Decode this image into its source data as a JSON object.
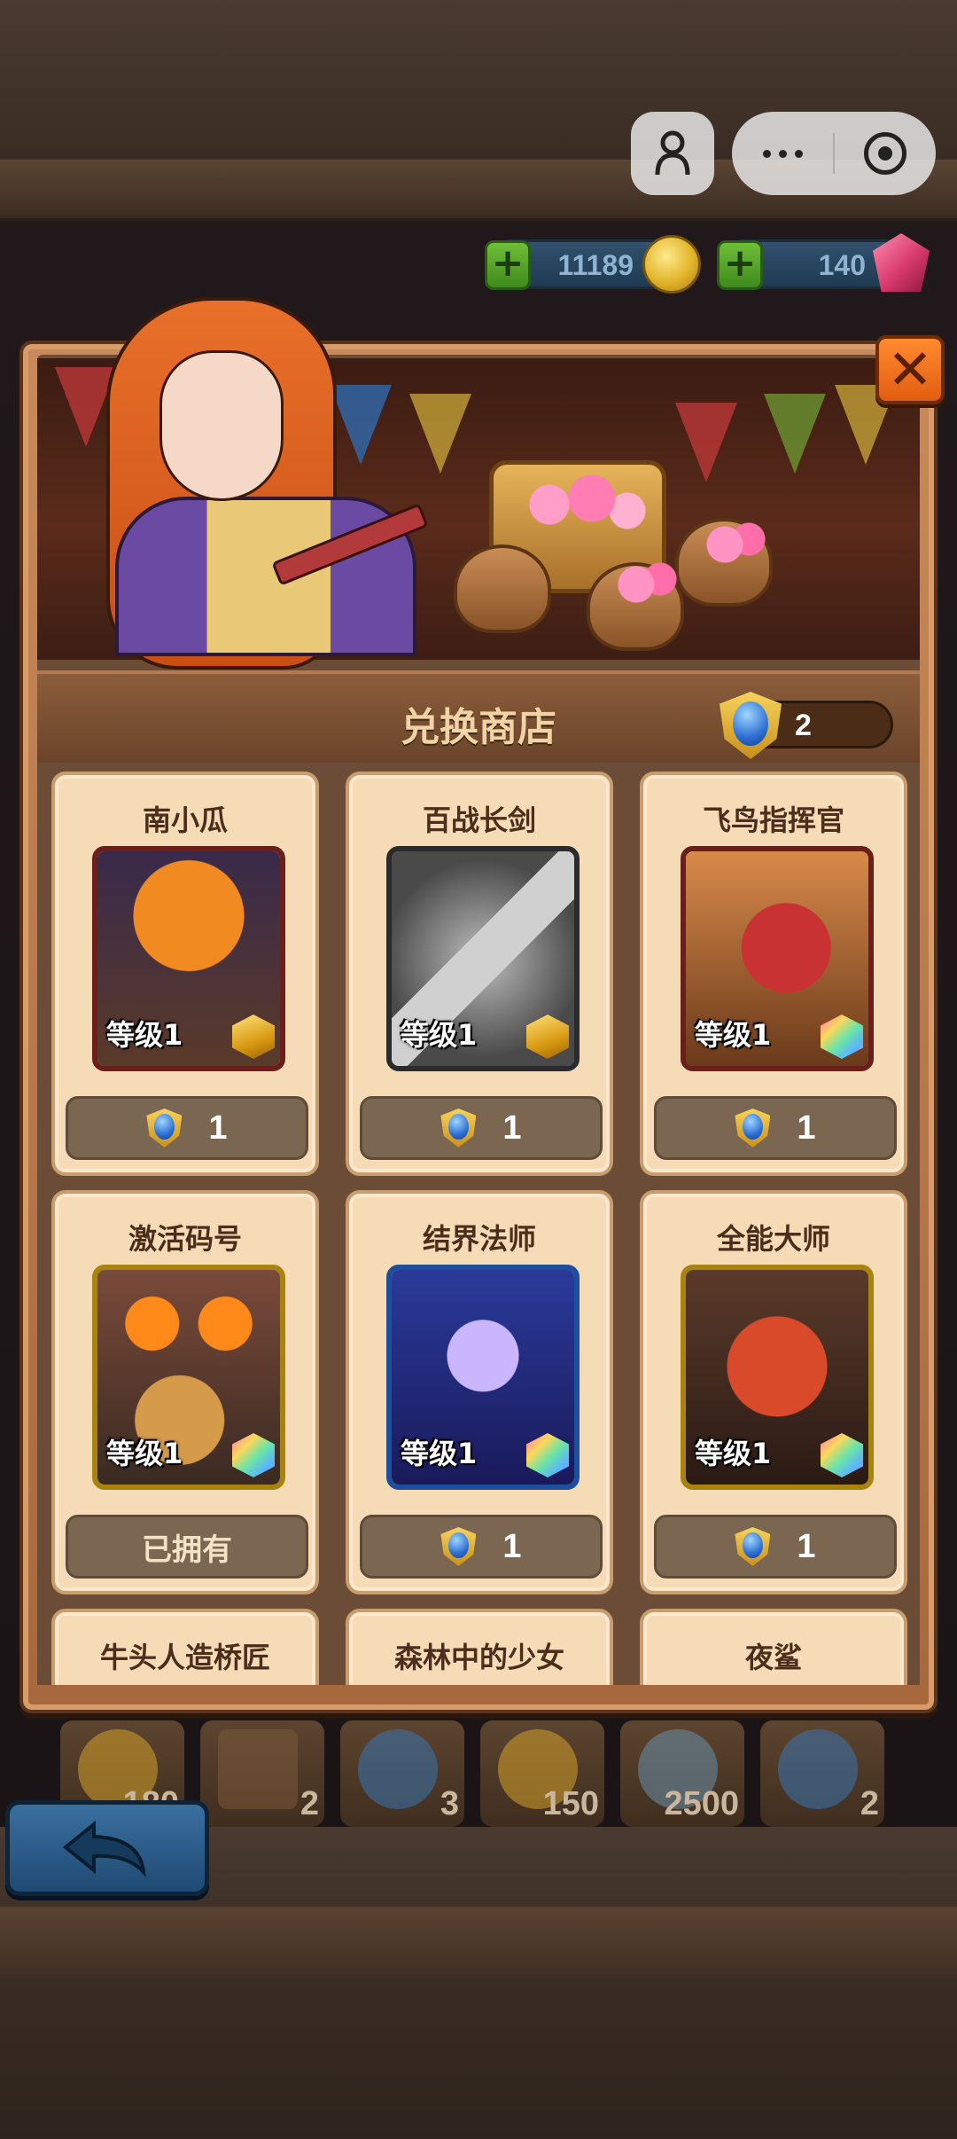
{
  "currency": {
    "gold": "11189",
    "gems": "140"
  },
  "shop": {
    "title": "兑换商店",
    "token_balance": "2"
  },
  "items": [
    {
      "name": "南小瓜",
      "level": "等级1",
      "price": "1",
      "owned_label": "",
      "rank": "gold",
      "frame": "#6b1f1b",
      "art": "pumpkin"
    },
    {
      "name": "百战长剑",
      "level": "等级1",
      "price": "1",
      "owned_label": "",
      "rank": "gold",
      "frame": "#2b2b2b",
      "art": "sword"
    },
    {
      "name": "飞鸟指挥官",
      "level": "等级1",
      "price": "1",
      "owned_label": "",
      "rank": "rainbow",
      "frame": "#6b1f1b",
      "art": "bird"
    },
    {
      "name": "激活码号",
      "level": "等级1",
      "price": "",
      "owned_label": "已拥有",
      "rank": "rainbow",
      "frame": "#a8840f",
      "art": "cat"
    },
    {
      "name": "结界法师",
      "level": "等级1",
      "price": "1",
      "owned_label": "",
      "rank": "rainbow",
      "frame": "#1d4f9e",
      "art": "mage"
    },
    {
      "name": "全能大师",
      "level": "等级1",
      "price": "1",
      "owned_label": "",
      "rank": "rainbow",
      "frame": "#a8840f",
      "art": "master"
    },
    {
      "name": "牛头人造桥匠",
      "level": "",
      "price": "",
      "owned_label": "",
      "rank": "",
      "frame": "",
      "art": ""
    },
    {
      "name": "森林中的少女",
      "level": "",
      "price": "",
      "owned_label": "",
      "rank": "",
      "frame": "",
      "art": ""
    },
    {
      "name": "夜鲨",
      "level": "",
      "price": "",
      "owned_label": "",
      "rank": "",
      "frame": "",
      "art": ""
    }
  ],
  "background_rewards": [
    "180",
    "2",
    "3",
    "150",
    "2500",
    "2"
  ],
  "icons": {
    "close": "close-icon",
    "back": "back-arrow-icon",
    "token": "blue-token-icon",
    "coin": "gold-coin-icon",
    "gem": "pink-gem-icon"
  },
  "colors": {
    "close_button": "#e25d12",
    "card_bg": "#f6dcb6",
    "price_button": "#7b6651",
    "back_button": "#1f4a73"
  }
}
